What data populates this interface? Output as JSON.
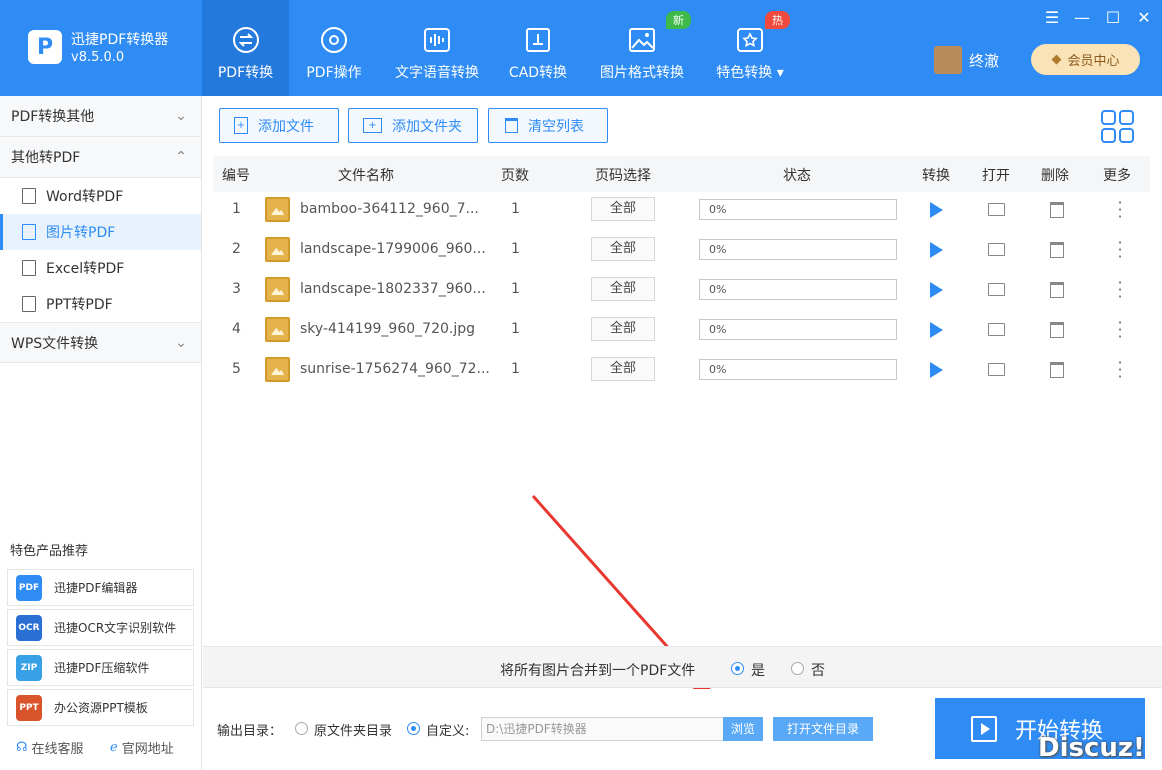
{
  "app": {
    "name": "迅捷PDF转换器",
    "version": "v8.5.0.0"
  },
  "nav": [
    {
      "label": "PDF转换",
      "icon": "convert-arrows-icon"
    },
    {
      "label": "PDF操作",
      "icon": "gear-icon"
    },
    {
      "label": "文字语音转换",
      "icon": "voice-wave-icon"
    },
    {
      "label": "CAD转换",
      "icon": "cad-icon"
    },
    {
      "label": "图片格式转换",
      "icon": "image-icon",
      "badge": "新"
    },
    {
      "label": "特色转换 ▾",
      "icon": "star-refresh-icon",
      "badge": "热"
    }
  ],
  "user": {
    "name": "终澈",
    "vip_label": "会员中心"
  },
  "window": {
    "menu": "☰",
    "minimize": "—",
    "maximize": "☐",
    "close": "✕"
  },
  "sidebar": {
    "groups": [
      {
        "label": "PDF转换其他",
        "arrow": "⌄"
      },
      {
        "label": "其他转PDF",
        "arrow": "⌃"
      },
      {
        "label": "WPS文件转换",
        "arrow": "⌄"
      }
    ],
    "items": [
      {
        "label": "Word转PDF"
      },
      {
        "label": "图片转PDF"
      },
      {
        "label": "Excel转PDF"
      },
      {
        "label": "PPT转PDF"
      }
    ],
    "rec_title": "特色产品推荐",
    "recommend": [
      {
        "label": "迅捷PDF编辑器",
        "icon_text": "PDF"
      },
      {
        "label": "迅捷OCR文字识别软件",
        "icon_text": "OCR"
      },
      {
        "label": "迅捷PDF压缩软件",
        "icon_text": "ZIP"
      },
      {
        "label": "办公资源PPT模板",
        "icon_text": "PPT"
      }
    ],
    "footer": {
      "support": "在线客服",
      "site": "官网地址"
    }
  },
  "toolbar": {
    "add_file": "添加文件",
    "add_folder": "添加文件夹",
    "clear": "清空列表"
  },
  "table": {
    "headers": {
      "no": "编号",
      "name": "文件名称",
      "pages": "页数",
      "page_sel": "页码选择",
      "status": "状态",
      "convert": "转换",
      "open": "打开",
      "delete": "删除",
      "more": "更多"
    },
    "rows": [
      {
        "no": "1",
        "name": "bamboo-364112_960_7...",
        "pages": "1",
        "page_sel": "全部",
        "status": "0%"
      },
      {
        "no": "2",
        "name": "landscape-1799006_960...",
        "pages": "1",
        "page_sel": "全部",
        "status": "0%"
      },
      {
        "no": "3",
        "name": "landscape-1802337_960...",
        "pages": "1",
        "page_sel": "全部",
        "status": "0%"
      },
      {
        "no": "4",
        "name": "sky-414199_960_720.jpg",
        "pages": "1",
        "page_sel": "全部",
        "status": "0%"
      },
      {
        "no": "5",
        "name": "sunrise-1756274_960_72...",
        "pages": "1",
        "page_sel": "全部",
        "status": "0%"
      }
    ]
  },
  "merge": {
    "label": "将所有图片合并到一个PDF文件",
    "yes": "是",
    "no": "否"
  },
  "output": {
    "label": "输出目录：",
    "opt_original": "原文件夹目录",
    "opt_custom": "自定义:",
    "path": "D:\\迅捷PDF转换器",
    "browse": "浏览",
    "open_dir": "打开文件目录"
  },
  "start": {
    "label": "开始转换"
  },
  "watermark": "Discuz!"
}
